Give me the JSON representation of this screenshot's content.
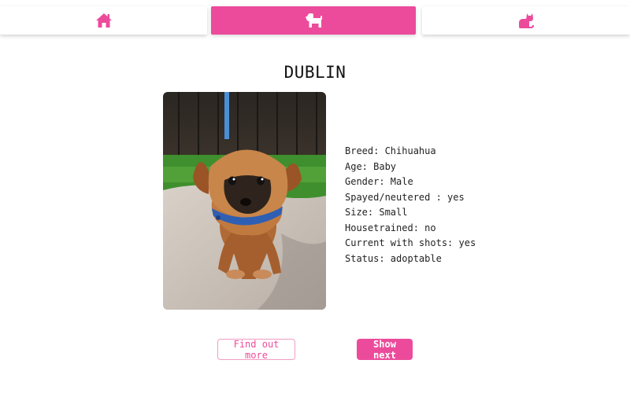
{
  "nav": {
    "tabs": [
      {
        "icon": "home-icon",
        "active": false
      },
      {
        "icon": "dog-icon",
        "active": true
      },
      {
        "icon": "cat-icon",
        "active": false
      }
    ],
    "accent_color": "#ec4b9b"
  },
  "pet": {
    "name": "DUBLIN",
    "photo": "puppy-photo",
    "details": [
      "Breed: Chihuahua",
      "Age: Baby",
      "Gender: Male",
      "Spayed/neutered : yes",
      "Size: Small",
      "Housetrained: no",
      "Current with shots: yes",
      "Status: adoptable"
    ]
  },
  "actions": {
    "find_out_more": "Find out more",
    "show_next": "Show next"
  }
}
